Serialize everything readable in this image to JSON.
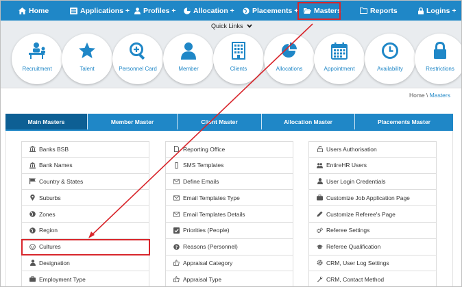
{
  "nav": {
    "items": [
      {
        "label": "Home",
        "icon": "home-icon"
      },
      {
        "label": "Applications +",
        "icon": "list-icon"
      },
      {
        "label": "Profiles +",
        "icon": "user-icon"
      },
      {
        "label": "Allocation +",
        "icon": "pie-icon"
      },
      {
        "label": "Placements +",
        "icon": "globe-icon"
      },
      {
        "label": "Masters",
        "icon": "folder-open-icon"
      },
      {
        "label": "Reports",
        "icon": "folder-icon"
      },
      {
        "label": "Logins +",
        "icon": "lock-icon"
      }
    ]
  },
  "quick_links": {
    "title": "Quick Links",
    "items": [
      {
        "label": "Recruitment",
        "icon": "recruitment-icon"
      },
      {
        "label": "Talent",
        "icon": "star-icon"
      },
      {
        "label": "Personnel Card",
        "icon": "zoom-in-icon"
      },
      {
        "label": "Member",
        "icon": "person-icon"
      },
      {
        "label": "Clients",
        "icon": "building-icon"
      },
      {
        "label": "Allocations",
        "icon": "pie-chart-icon"
      },
      {
        "label": "Appointment",
        "icon": "calendar-icon"
      },
      {
        "label": "Availability",
        "icon": "clock-icon"
      },
      {
        "label": "Restrictions",
        "icon": "lock-icon"
      }
    ]
  },
  "breadcrumb": {
    "home": "Home",
    "separator": "\\",
    "current": "Masters"
  },
  "tabs": [
    {
      "label": "Main Masters",
      "active": true
    },
    {
      "label": "Member Master",
      "active": false
    },
    {
      "label": "Client Master",
      "active": false
    },
    {
      "label": "Allocation Master",
      "active": false
    },
    {
      "label": "Placements Master",
      "active": false
    }
  ],
  "columns": [
    [
      {
        "label": "Banks BSB",
        "icon": "bank-icon"
      },
      {
        "label": "Bank Names",
        "icon": "bank-icon"
      },
      {
        "label": "Country & States",
        "icon": "flag-icon"
      },
      {
        "label": "Suburbs",
        "icon": "map-marker-icon"
      },
      {
        "label": "Zones",
        "icon": "globe-icon"
      },
      {
        "label": "Region",
        "icon": "globe-icon"
      },
      {
        "label": "Cultures",
        "icon": "smile-icon"
      },
      {
        "label": "Designation",
        "icon": "user-icon"
      },
      {
        "label": "Employment Type",
        "icon": "briefcase-icon"
      }
    ],
    [
      {
        "label": "Reporting Office",
        "icon": "file-icon"
      },
      {
        "label": "SMS Templates",
        "icon": "mobile-icon"
      },
      {
        "label": "Define Emails",
        "icon": "envelope-icon"
      },
      {
        "label": "Email Templates Type",
        "icon": "envelope-icon"
      },
      {
        "label": "Email Templates Details",
        "icon": "envelope-icon"
      },
      {
        "label": "Priorities (People)",
        "icon": "check-square-icon"
      },
      {
        "label": "Reasons (Personnel)",
        "icon": "question-circle-icon"
      },
      {
        "label": "Appraisal Category",
        "icon": "thumbs-up-icon"
      },
      {
        "label": "Appraisal Type",
        "icon": "thumbs-up-icon"
      }
    ],
    [
      {
        "label": "Users Authorisation",
        "icon": "unlock-icon"
      },
      {
        "label": "EntireHR Users",
        "icon": "users-icon"
      },
      {
        "label": "User Login Credentials",
        "icon": "user-icon"
      },
      {
        "label": "Customize Job Application Page",
        "icon": "briefcase-icon"
      },
      {
        "label": "Customize Referee's Page",
        "icon": "pencil-icon"
      },
      {
        "label": "Referee Settings",
        "icon": "cogs-icon"
      },
      {
        "label": "Referee Qualification",
        "icon": "graduation-cap-icon"
      },
      {
        "label": "CRM, User Log Settings",
        "icon": "cog-icon"
      },
      {
        "label": "CRM, Contact Method",
        "icon": "wrench-icon"
      }
    ]
  ],
  "colors": {
    "primary": "#1f87c7",
    "active_tab": "#0d5f94",
    "highlight": "#d8252b"
  }
}
